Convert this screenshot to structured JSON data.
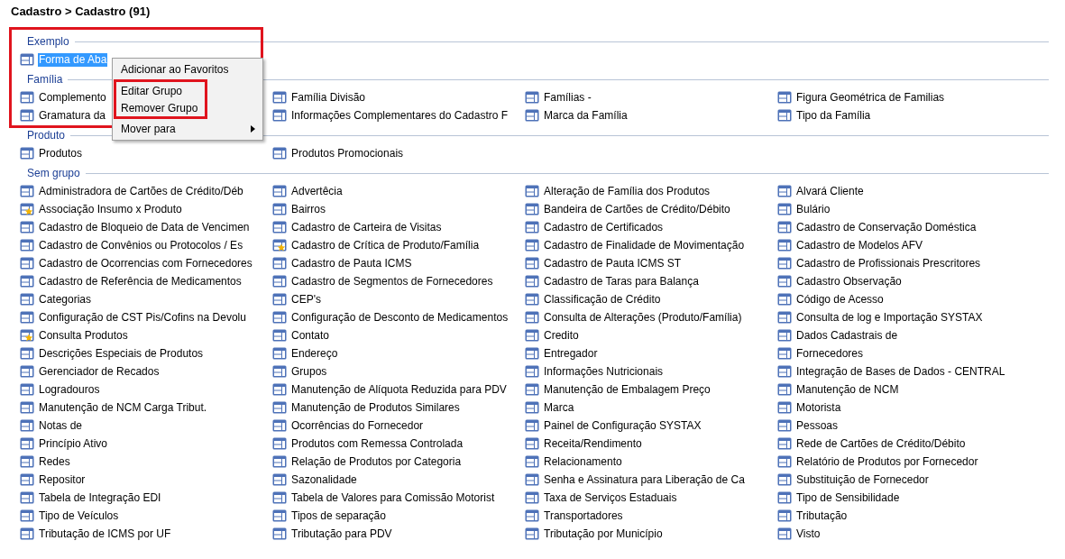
{
  "breadcrumb": "Cadastro > Cadastro (91)",
  "annotation": {
    "frame_around_groups": true
  },
  "groups": [
    {
      "title": "Exemplo",
      "items": [
        {
          "label": "Forma de Aba",
          "kind": "form",
          "selected": true
        }
      ]
    },
    {
      "title": "Família",
      "items": [
        {
          "label": "Complemento",
          "kind": "form",
          "selected": false
        },
        {
          "label": "Família Divisão",
          "kind": "form",
          "selected": false
        },
        {
          "label": "Famílias -",
          "kind": "form",
          "selected": false
        },
        {
          "label": "Figura Geométrica de Familias",
          "kind": "form",
          "selected": false
        },
        {
          "label": "Gramatura da",
          "kind": "form",
          "selected": false
        },
        {
          "label": "Informações Complementares do Cadastro F",
          "kind": "form",
          "selected": false
        },
        {
          "label": "Marca da Família",
          "kind": "form",
          "selected": false
        },
        {
          "label": "Tipo da Família",
          "kind": "form",
          "selected": false
        }
      ]
    },
    {
      "title": "Produto",
      "items": [
        {
          "label": "Produtos",
          "kind": "form",
          "selected": false
        },
        {
          "label": "Produtos Promocionais",
          "kind": "form",
          "selected": false
        }
      ]
    },
    {
      "title": "Sem grupo",
      "items": [
        {
          "label": "Administradora de Cartões de Crédito/Déb",
          "kind": "form",
          "selected": false
        },
        {
          "label": "Advertêcia",
          "kind": "form",
          "selected": false
        },
        {
          "label": "Alteração de Família dos Produtos",
          "kind": "form",
          "selected": false
        },
        {
          "label": "Alvará Cliente",
          "kind": "form",
          "selected": false
        },
        {
          "label": "Associação Insumo x Produto",
          "kind": "favorite",
          "selected": false
        },
        {
          "label": "Bairros",
          "kind": "form",
          "selected": false
        },
        {
          "label": "Bandeira de Cartões de Crédito/Débito",
          "kind": "form",
          "selected": false
        },
        {
          "label": "Bulário",
          "kind": "form",
          "selected": false
        },
        {
          "label": "Cadastro de Bloqueio de Data de Vencimen",
          "kind": "form",
          "selected": false
        },
        {
          "label": "Cadastro de Carteira de Visitas",
          "kind": "form",
          "selected": false
        },
        {
          "label": "Cadastro de Certificados",
          "kind": "form",
          "selected": false
        },
        {
          "label": "Cadastro de Conservação Doméstica",
          "kind": "form",
          "selected": false
        },
        {
          "label": "Cadastro de Convênios ou Protocolos / Es",
          "kind": "form",
          "selected": false
        },
        {
          "label": "Cadastro de Crítica de Produto/Família",
          "kind": "favorite",
          "selected": false
        },
        {
          "label": "Cadastro de Finalidade de Movimentação",
          "kind": "form",
          "selected": false
        },
        {
          "label": "Cadastro de Modelos AFV",
          "kind": "form",
          "selected": false
        },
        {
          "label": "Cadastro de Ocorrencias com Fornecedores",
          "kind": "form",
          "selected": false
        },
        {
          "label": "Cadastro de Pauta ICMS",
          "kind": "form",
          "selected": false
        },
        {
          "label": "Cadastro de Pauta ICMS ST",
          "kind": "form",
          "selected": false
        },
        {
          "label": "Cadastro de Profissionais Prescritores",
          "kind": "form",
          "selected": false
        },
        {
          "label": "Cadastro de Referência de Medicamentos",
          "kind": "form",
          "selected": false
        },
        {
          "label": "Cadastro de Segmentos de Fornecedores",
          "kind": "form",
          "selected": false
        },
        {
          "label": "Cadastro de Taras para Balança",
          "kind": "form",
          "selected": false
        },
        {
          "label": "Cadastro Observação",
          "kind": "form",
          "selected": false
        },
        {
          "label": "Categorias",
          "kind": "form",
          "selected": false
        },
        {
          "label": "CEP's",
          "kind": "form",
          "selected": false
        },
        {
          "label": "Classificação de Crédito",
          "kind": "form",
          "selected": false
        },
        {
          "label": "Código de Acesso",
          "kind": "form",
          "selected": false
        },
        {
          "label": "Configuração de CST Pis/Cofins na Devolu",
          "kind": "form",
          "selected": false
        },
        {
          "label": "Configuração de Desconto de Medicamentos",
          "kind": "form",
          "selected": false
        },
        {
          "label": "Consulta de Alterações (Produto/Família)",
          "kind": "form",
          "selected": false
        },
        {
          "label": "Consulta de log e Importação SYSTAX",
          "kind": "form",
          "selected": false
        },
        {
          "label": "Consulta Produtos",
          "kind": "favorite",
          "selected": false
        },
        {
          "label": "Contato",
          "kind": "form",
          "selected": false
        },
        {
          "label": "Credito",
          "kind": "form",
          "selected": false
        },
        {
          "label": "Dados Cadastrais de",
          "kind": "form",
          "selected": false
        },
        {
          "label": "Descrições Especiais de Produtos",
          "kind": "form",
          "selected": false
        },
        {
          "label": "Endereço",
          "kind": "form",
          "selected": false
        },
        {
          "label": "Entregador",
          "kind": "form",
          "selected": false
        },
        {
          "label": "Fornecedores",
          "kind": "form",
          "selected": false
        },
        {
          "label": "Gerenciador de Recados",
          "kind": "form",
          "selected": false
        },
        {
          "label": "Grupos",
          "kind": "form",
          "selected": false
        },
        {
          "label": "Informações Nutricionais",
          "kind": "form",
          "selected": false
        },
        {
          "label": "Integração de Bases de Dados - CENTRAL",
          "kind": "form",
          "selected": false
        },
        {
          "label": "Logradouros",
          "kind": "form",
          "selected": false
        },
        {
          "label": "Manutenção de Alíquota Reduzida para PDV",
          "kind": "form",
          "selected": false
        },
        {
          "label": "Manutenção de Embalagem Preço",
          "kind": "form",
          "selected": false
        },
        {
          "label": "Manutenção de NCM",
          "kind": "form",
          "selected": false
        },
        {
          "label": "Manutenção de NCM Carga Tribut.",
          "kind": "form",
          "selected": false
        },
        {
          "label": "Manutenção de Produtos Similares",
          "kind": "form",
          "selected": false
        },
        {
          "label": "Marca",
          "kind": "form",
          "selected": false
        },
        {
          "label": "Motorista",
          "kind": "form",
          "selected": false
        },
        {
          "label": "Notas de",
          "kind": "form",
          "selected": false
        },
        {
          "label": "Ocorrências do Fornecedor",
          "kind": "form",
          "selected": false
        },
        {
          "label": "Painel de Configuração SYSTAX",
          "kind": "form",
          "selected": false
        },
        {
          "label": "Pessoas",
          "kind": "form",
          "selected": false
        },
        {
          "label": "Princípio Ativo",
          "kind": "form",
          "selected": false
        },
        {
          "label": "Produtos com Remessa Controlada",
          "kind": "form",
          "selected": false
        },
        {
          "label": "Receita/Rendimento",
          "kind": "form",
          "selected": false
        },
        {
          "label": "Rede de Cartões de Crédito/Débito",
          "kind": "form",
          "selected": false
        },
        {
          "label": "Redes",
          "kind": "form",
          "selected": false
        },
        {
          "label": "Relação de Produtos por Categoria",
          "kind": "form",
          "selected": false
        },
        {
          "label": "Relacionamento",
          "kind": "form",
          "selected": false
        },
        {
          "label": "Relatório de Produtos por Fornecedor",
          "kind": "form",
          "selected": false
        },
        {
          "label": "Repositor",
          "kind": "form",
          "selected": false
        },
        {
          "label": "Sazonalidade",
          "kind": "form",
          "selected": false
        },
        {
          "label": "Senha e  Assinatura para Liberação de Ca",
          "kind": "form",
          "selected": false
        },
        {
          "label": "Substituição de Fornecedor",
          "kind": "form",
          "selected": false
        },
        {
          "label": "Tabela de Integração EDI",
          "kind": "form",
          "selected": false
        },
        {
          "label": "Tabela de Valores para Comissão Motorist",
          "kind": "form",
          "selected": false
        },
        {
          "label": "Taxa de Serviços Estaduais",
          "kind": "form",
          "selected": false
        },
        {
          "label": "Tipo de Sensibilidade",
          "kind": "form",
          "selected": false
        },
        {
          "label": "Tipo de Veículos",
          "kind": "form",
          "selected": false
        },
        {
          "label": "Tipos de separação",
          "kind": "form",
          "selected": false
        },
        {
          "label": "Transportadores",
          "kind": "form",
          "selected": false
        },
        {
          "label": "Tributação",
          "kind": "form",
          "selected": false
        },
        {
          "label": "Tributação de ICMS por UF",
          "kind": "form",
          "selected": false
        },
        {
          "label": "Tributação para PDV",
          "kind": "form",
          "selected": false
        },
        {
          "label": "Tributação por Município",
          "kind": "form",
          "selected": false
        },
        {
          "label": "Visto",
          "kind": "form",
          "selected": false
        }
      ]
    }
  ],
  "context_menu": {
    "items": [
      {
        "label": "Adicionar ao Favoritos",
        "submenu": false,
        "outlined": false
      },
      {
        "label": "Editar Grupo",
        "submenu": false,
        "outlined": true
      },
      {
        "label": "Remover Grupo",
        "submenu": false,
        "outlined": true
      },
      {
        "label": "Mover para",
        "submenu": true,
        "outlined": false
      }
    ]
  }
}
